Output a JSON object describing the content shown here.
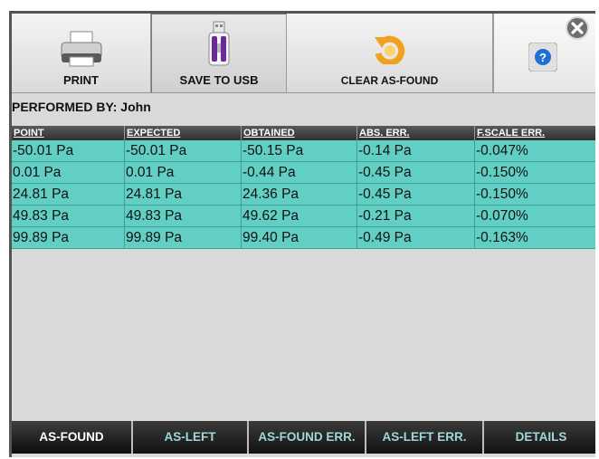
{
  "toolbar": {
    "print_label": "PRINT",
    "usb_label": "SAVE TO USB",
    "clear_label": "CLEAR AS-FOUND"
  },
  "performed_by": "PERFORMED BY: John",
  "table": {
    "headers": [
      "POINT",
      "EXPECTED",
      "OBTAINED",
      "ABS. ERR.",
      "F.SCALE ERR."
    ],
    "rows": [
      [
        "-50.01 Pa",
        "-50.01 Pa",
        "-50.15 Pa",
        "-0.14 Pa",
        "-0.047%"
      ],
      [
        "0.01 Pa",
        "0.01 Pa",
        "-0.44 Pa",
        "-0.45 Pa",
        "-0.150%"
      ],
      [
        "24.81 Pa",
        "24.81 Pa",
        "24.36 Pa",
        "-0.45 Pa",
        "-0.150%"
      ],
      [
        "49.83 Pa",
        "49.83 Pa",
        "49.62 Pa",
        "-0.21 Pa",
        "-0.070%"
      ],
      [
        "99.89 Pa",
        "99.89 Pa",
        "99.40 Pa",
        "-0.49 Pa",
        "-0.163%"
      ]
    ]
  },
  "tabs": [
    {
      "label": "AS-FOUND",
      "active": true
    },
    {
      "label": "AS-LEFT",
      "active": false
    },
    {
      "label": "AS-FOUND ERR.",
      "active": false
    },
    {
      "label": "AS-LEFT ERR.",
      "active": false
    },
    {
      "label": "DETAILS",
      "active": false
    }
  ],
  "icons": {
    "print": "printer-icon",
    "usb": "usb-drive-icon",
    "clear": "clear-arrow-icon",
    "help": "help-icon",
    "close": "close-icon"
  },
  "colors": {
    "row_bg": "#62cfc4",
    "help_blue": "#1e6fd6",
    "clear_orange": "#f2a11f"
  }
}
